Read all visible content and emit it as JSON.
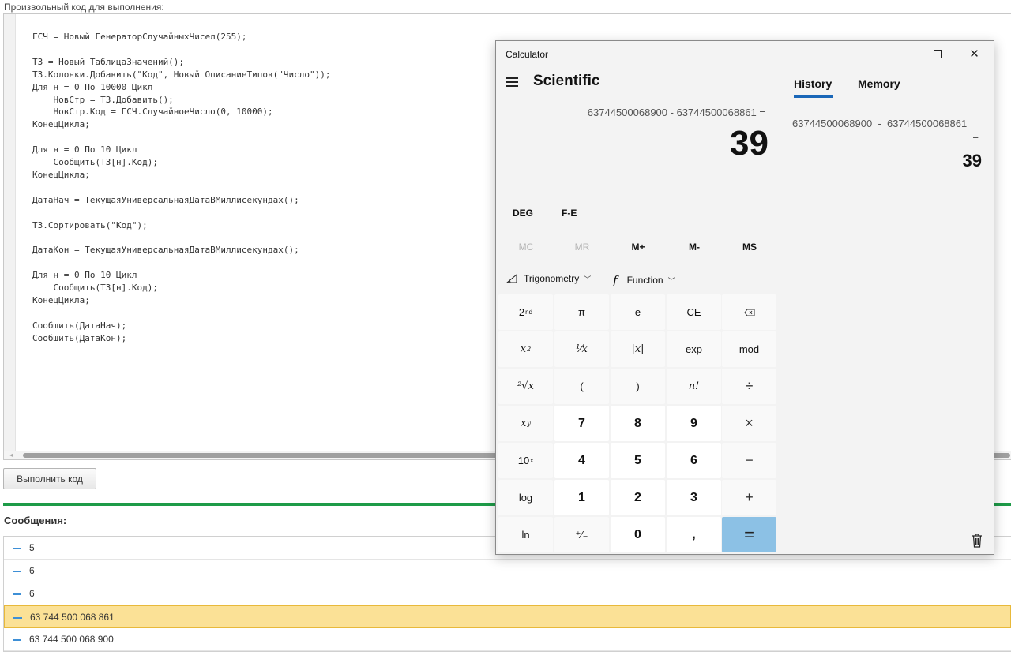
{
  "page": {
    "caption": "Произвольный код для выполнения:",
    "code": "ГСЧ = Новый ГенераторСлучайныхЧисел(255);\n\nТЗ = Новый ТаблицаЗначений();\nТЗ.Колонки.Добавить(\"Код\", Новый ОписаниеТипов(\"Число\"));\nДля н = 0 По 10000 Цикл\n    НовСтр = ТЗ.Добавить();\n    НовСтр.Код = ГСЧ.СлучайноеЧисло(0, 10000);\nКонецЦикла;\n\nДля н = 0 По 10 Цикл\n    Сообщить(ТЗ[н].Код);\nКонецЦикла;\n\nДатаНач = ТекущаяУниверсальнаяДатаВМиллисекундах();\n\nТЗ.Сортировать(\"Код\");\n\nДатаКон = ТекущаяУниверсальнаяДатаВМиллисекундах();\n\nДля н = 0 По 10 Цикл\n    Сообщить(ТЗ[н].Код);\nКонецЦикла;\n\nСообщить(ДатаНач);\nСообщить(ДатаКон);",
    "run_button": "Выполнить код",
    "messages_title": "Сообщения:",
    "messages": [
      "5",
      "6",
      "6",
      "63 744 500 068 861",
      "63 744 500 068 900"
    ],
    "selected_message_index": 3
  },
  "calculator": {
    "title": "Calculator",
    "mode": "Scientific",
    "expression": "63744500068900 - 63744500068861 =",
    "result": "39",
    "angle_mode": "DEG",
    "fe_label": "F-E",
    "memory_buttons": [
      "MC",
      "MR",
      "M+",
      "M-",
      "MS"
    ],
    "trig_label": "Trigonometry",
    "function_label": "Function",
    "keys": {
      "second": "2",
      "second_sup": "nd",
      "pi": "π",
      "e": "e",
      "ce": "CE",
      "square": "x",
      "square_sup": "2",
      "reciprocal": "⅟x",
      "abs": "|x|",
      "exp": "exp",
      "mod": "mod",
      "root": "²√x",
      "lparen": "(",
      "rparen": ")",
      "factorial": "n!",
      "divide": "÷",
      "power": "x",
      "power_sup": "y",
      "seven": "7",
      "eight": "8",
      "nine": "9",
      "multiply": "×",
      "tenpow": "10",
      "tenpow_sup": "x",
      "four": "4",
      "five": "5",
      "six": "6",
      "minus": "−",
      "log": "log",
      "one": "1",
      "two": "2",
      "three": "3",
      "plus": "+",
      "ln": "ln",
      "negate": "⁺∕₋",
      "zero": "0",
      "decimal": ",",
      "equals": "="
    },
    "tabs": [
      "History",
      "Memory"
    ],
    "active_tab": "History",
    "history": {
      "expression": "63744500068900  -  63744500068861",
      "equals": "=",
      "result": "39"
    }
  }
}
